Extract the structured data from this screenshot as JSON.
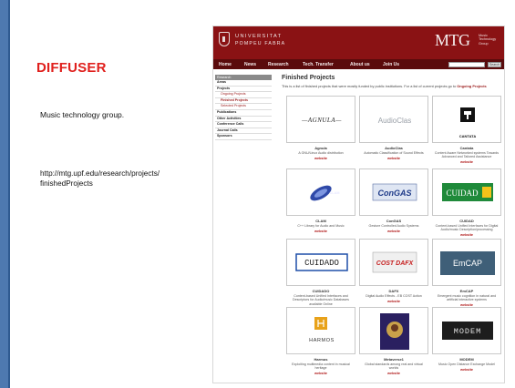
{
  "slide": {
    "title": "DIFFUSER",
    "description": "Music technology group.",
    "url": "http://mtg.upf.edu/research/projects/\nfinishedProjects",
    "colors": {
      "title": "#e0201d",
      "side_bar": "#4e79b0"
    }
  },
  "site": {
    "university_line1": "UNIVERSITAT",
    "university_line2": "POMPEU FABRA",
    "brand": "MTG",
    "brand_sub": "Music Technology Group",
    "nav": [
      "Home",
      "News",
      "Research",
      "Tech. Transfer",
      "About us",
      "Join Us"
    ],
    "search_button": "Search",
    "menu": {
      "head": "Research",
      "items": [
        {
          "label": "Areas",
          "level": "top"
        },
        {
          "label": "Projects",
          "level": "top"
        },
        {
          "label": "Ongoing Projects",
          "level": "sub"
        },
        {
          "label": "Finished Projects",
          "level": "sub-active"
        },
        {
          "label": "Selected Projects",
          "level": "sub"
        },
        {
          "label": "Publications",
          "level": "top"
        },
        {
          "label": "Other Activities",
          "level": "top"
        },
        {
          "label": "Conference Calls",
          "level": "top"
        },
        {
          "label": "Journal Calls",
          "level": "top"
        },
        {
          "label": "Sponsors",
          "level": "top"
        }
      ]
    },
    "content": {
      "title": "Finished Projects",
      "intro": "This is a list of finished projects that were mostly funded by public institutions. For a list of current projects go to",
      "intro_link": "Ongoing Projects"
    },
    "projects": [
      {
        "name": "Agnula",
        "desc": "A GNU/Linux Audio distribution",
        "link": "website",
        "logo": "—AGNULA—"
      },
      {
        "name": "AudioClas",
        "desc": "Automatic Classification of Sound Effects",
        "link": "website",
        "logo": "AudioClas"
      },
      {
        "name": "Cantata",
        "desc": "Content Aware Networked systems Towards Advanced and Tailored Assistance",
        "link": "website",
        "logo": "CANTATA"
      },
      {
        "name": "CLAM",
        "desc": "C++ Library for Audio and Music",
        "link": "website",
        "logo": "CLAM"
      },
      {
        "name": "ConGAS",
        "desc": "Gesture Controlled Audio Systems",
        "link": "website",
        "logo": "ConGAS"
      },
      {
        "name": "CUIDAD",
        "desc": "Content-based Unified Interfaces for Digital Audio/music Description/processing",
        "link": "website",
        "logo": "CUIDAD"
      },
      {
        "name": "CUIDADO",
        "desc": "Content-based Unified Interfaces and Descriptors for Audio/music Databases available Online",
        "link": "website",
        "logo": "CUIDADO"
      },
      {
        "name": "DAFX",
        "desc": "Digital Audio Effects - EB COST Action",
        "link": "website",
        "logo": "COST DAFX"
      },
      {
        "name": "EmCAP",
        "desc": "Emergent music cognition in natural and artificial interactive systems",
        "link": "website",
        "logo": "EmCAP"
      },
      {
        "name": "Harmos",
        "desc": "Exploiting multimedia content in musical heritage",
        "link": "website",
        "logo": "HARMOS"
      },
      {
        "name": "Metaverse1",
        "desc": "Global standards among real and virtual worlds",
        "link": "website",
        "logo": ""
      },
      {
        "name": "MODEM",
        "desc": "Music Open Distance Exchange Model",
        "link": "website",
        "logo": "MODEM"
      }
    ]
  }
}
